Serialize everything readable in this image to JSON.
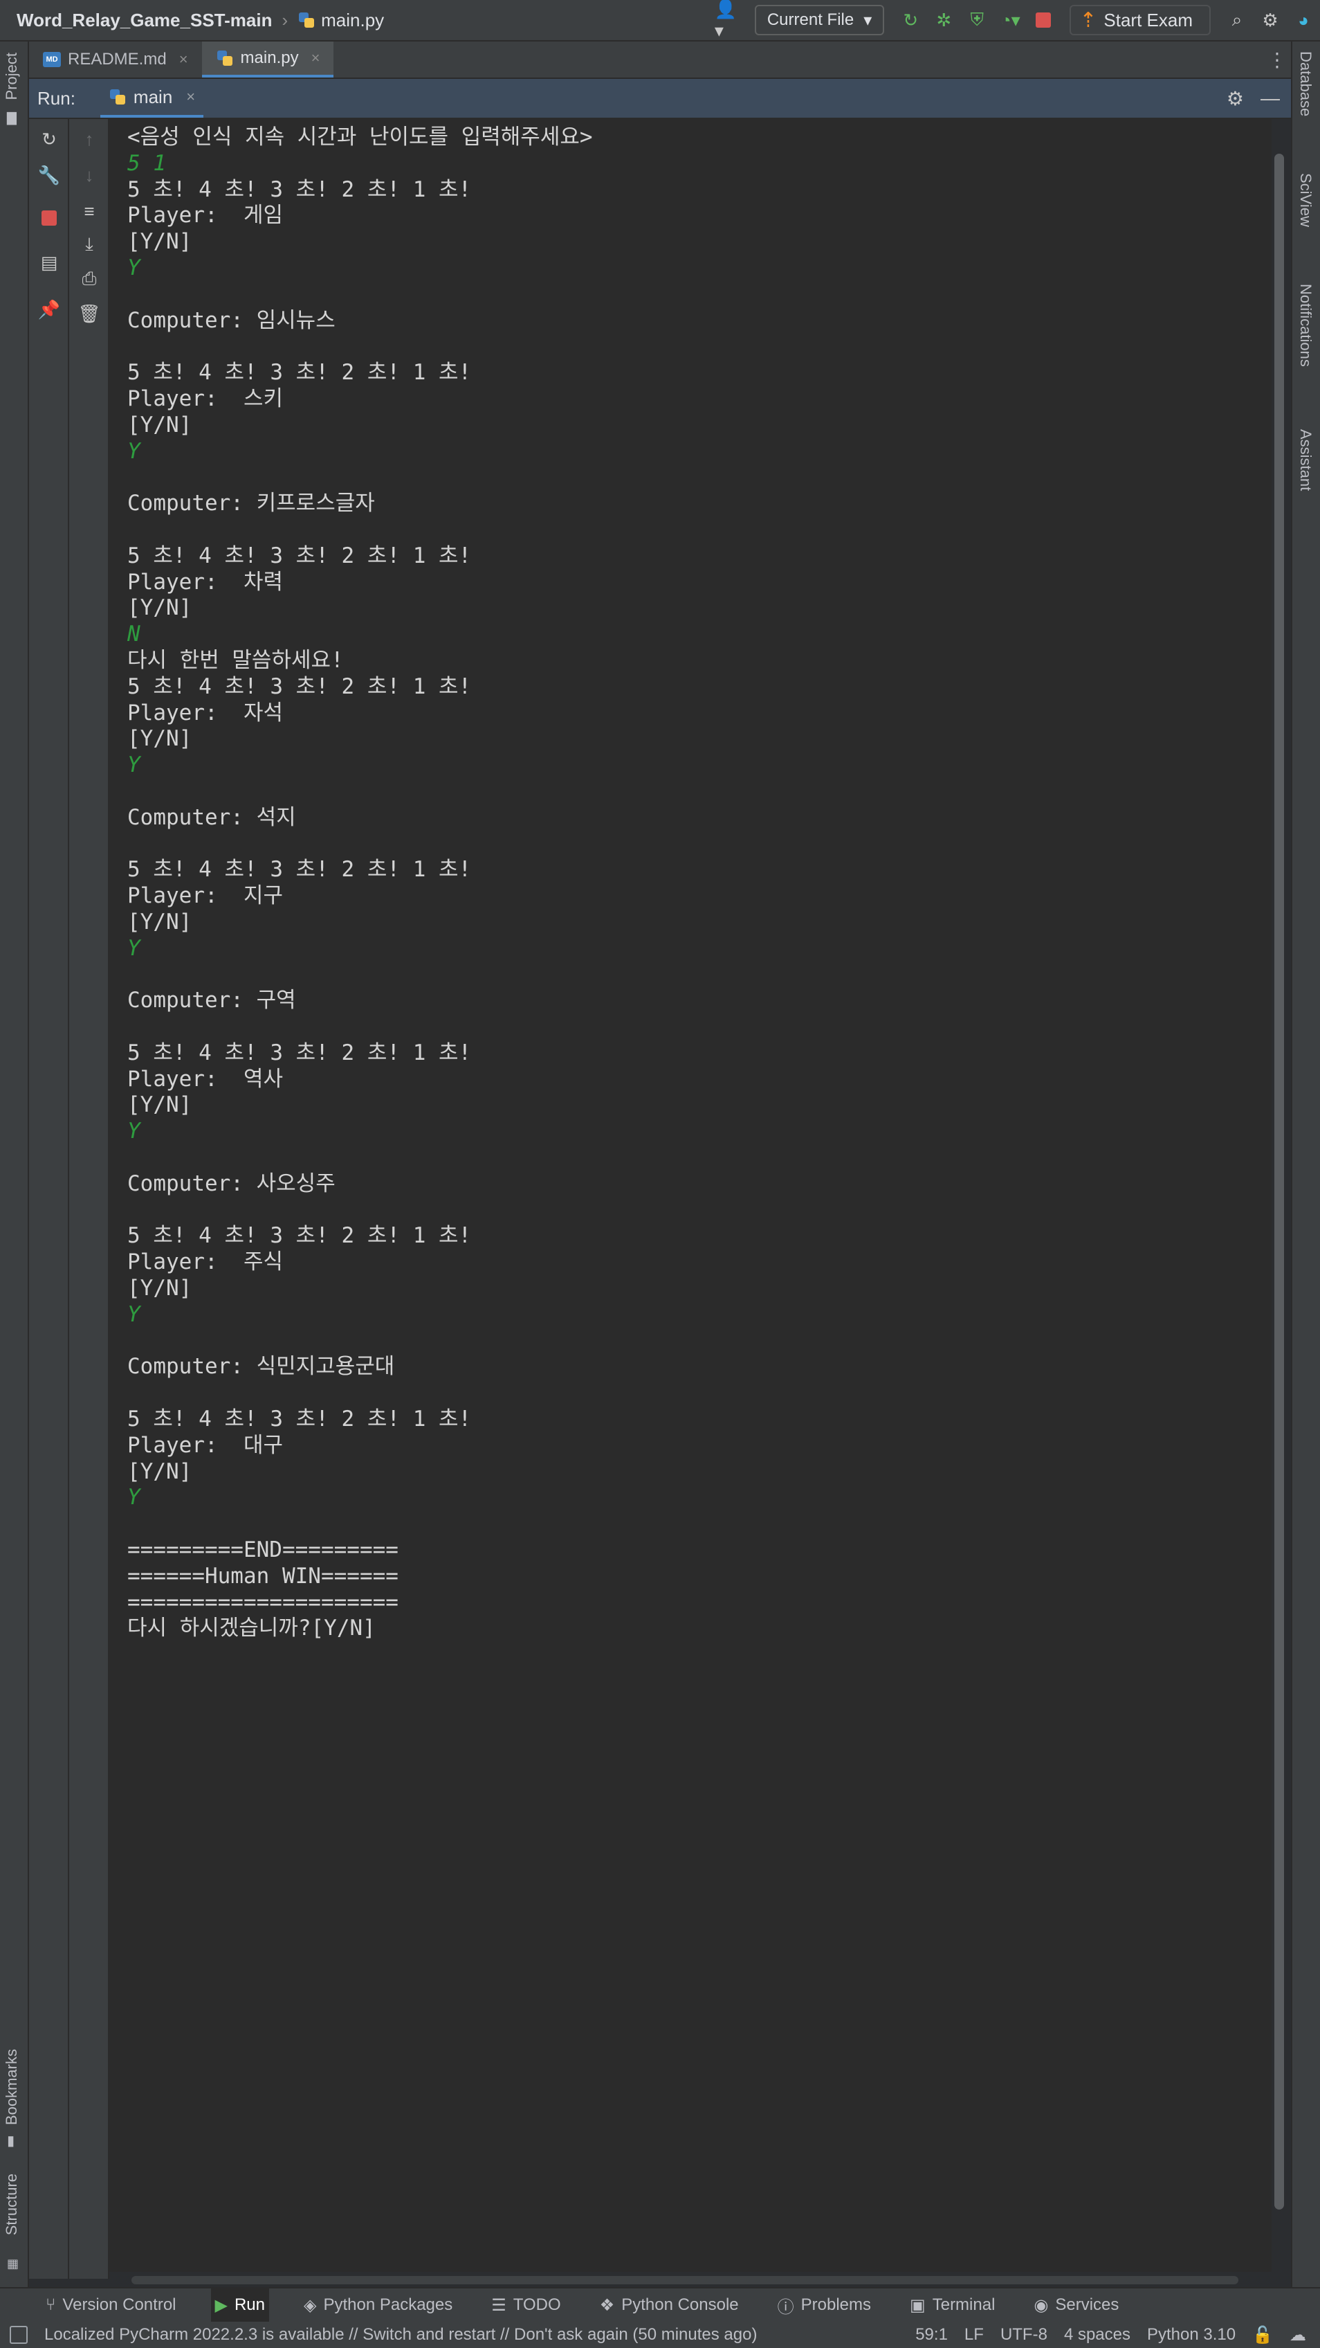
{
  "titlebar": {
    "project": "Word_Relay_Game_SST-main",
    "file": "main.py",
    "run_config": "Current File",
    "exam_label": "Start Exam"
  },
  "left_strip": {
    "project_label": "Project",
    "bookmarks_label": "Bookmarks",
    "structure_label": "Structure"
  },
  "right_strip": {
    "database_label": "Database",
    "sciview_label": "SciView",
    "notifications_label": "Notifications",
    "assistant_label": "Assistant"
  },
  "tabs": [
    {
      "label": "README.md",
      "icon": "markdown-icon",
      "active": false
    },
    {
      "label": "main.py",
      "icon": "python-icon",
      "active": true
    }
  ],
  "run": {
    "label": "Run:",
    "tab": "main"
  },
  "console": [
    {
      "text": "<음성 인식 지속 시간과 난이도를 입력해주세요>",
      "input": false
    },
    {
      "text": "5 1",
      "input": true
    },
    {
      "text": "5 초! 4 초! 3 초! 2 초! 1 초!",
      "input": false
    },
    {
      "text": "Player:  게임",
      "input": false
    },
    {
      "text": "[Y/N]",
      "input": false
    },
    {
      "text": "Y",
      "input": true
    },
    {
      "text": "",
      "input": false
    },
    {
      "text": "Computer: 임시뉴스",
      "input": false
    },
    {
      "text": "",
      "input": false
    },
    {
      "text": "5 초! 4 초! 3 초! 2 초! 1 초!",
      "input": false
    },
    {
      "text": "Player:  스키",
      "input": false
    },
    {
      "text": "[Y/N]",
      "input": false
    },
    {
      "text": "Y",
      "input": true
    },
    {
      "text": "",
      "input": false
    },
    {
      "text": "Computer: 키프로스글자",
      "input": false
    },
    {
      "text": "",
      "input": false
    },
    {
      "text": "5 초! 4 초! 3 초! 2 초! 1 초!",
      "input": false
    },
    {
      "text": "Player:  차력",
      "input": false
    },
    {
      "text": "[Y/N]",
      "input": false
    },
    {
      "text": "N",
      "input": true
    },
    {
      "text": "다시 한번 말씀하세요!",
      "input": false
    },
    {
      "text": "5 초! 4 초! 3 초! 2 초! 1 초!",
      "input": false
    },
    {
      "text": "Player:  자석",
      "input": false
    },
    {
      "text": "[Y/N]",
      "input": false
    },
    {
      "text": "Y",
      "input": true
    },
    {
      "text": "",
      "input": false
    },
    {
      "text": "Computer: 석지",
      "input": false
    },
    {
      "text": "",
      "input": false
    },
    {
      "text": "5 초! 4 초! 3 초! 2 초! 1 초!",
      "input": false
    },
    {
      "text": "Player:  지구",
      "input": false
    },
    {
      "text": "[Y/N]",
      "input": false
    },
    {
      "text": "Y",
      "input": true
    },
    {
      "text": "",
      "input": false
    },
    {
      "text": "Computer: 구역",
      "input": false
    },
    {
      "text": "",
      "input": false
    },
    {
      "text": "5 초! 4 초! 3 초! 2 초! 1 초!",
      "input": false
    },
    {
      "text": "Player:  역사",
      "input": false
    },
    {
      "text": "[Y/N]",
      "input": false
    },
    {
      "text": "Y",
      "input": true
    },
    {
      "text": "",
      "input": false
    },
    {
      "text": "Computer: 사오싱주",
      "input": false
    },
    {
      "text": "",
      "input": false
    },
    {
      "text": "5 초! 4 초! 3 초! 2 초! 1 초!",
      "input": false
    },
    {
      "text": "Player:  주식",
      "input": false
    },
    {
      "text": "[Y/N]",
      "input": false
    },
    {
      "text": "Y",
      "input": true
    },
    {
      "text": "",
      "input": false
    },
    {
      "text": "Computer: 식민지고용군대",
      "input": false
    },
    {
      "text": "",
      "input": false
    },
    {
      "text": "5 초! 4 초! 3 초! 2 초! 1 초!",
      "input": false
    },
    {
      "text": "Player:  대구",
      "input": false
    },
    {
      "text": "[Y/N]",
      "input": false
    },
    {
      "text": "Y",
      "input": true
    },
    {
      "text": "",
      "input": false
    },
    {
      "text": "=========END=========",
      "input": false
    },
    {
      "text": "======Human WIN======",
      "input": false
    },
    {
      "text": "=====================",
      "input": false
    },
    {
      "text": "다시 하시겠습니까?[Y/N]",
      "input": false
    }
  ],
  "toolwindows": [
    {
      "label": "Version Control",
      "icon": "branch-icon",
      "active": false
    },
    {
      "label": "Run",
      "icon": "run-icon",
      "active": true
    },
    {
      "label": "Python Packages",
      "icon": "layers-icon",
      "active": false
    },
    {
      "label": "TODO",
      "icon": "list-icon",
      "active": false
    },
    {
      "label": "Python Console",
      "icon": "python-console-icon",
      "active": false
    },
    {
      "label": "Problems",
      "icon": "warning-icon",
      "active": false
    },
    {
      "label": "Terminal",
      "icon": "terminal-icon",
      "active": false
    },
    {
      "label": "Services",
      "icon": "services-icon",
      "active": false
    }
  ],
  "status": {
    "message": "Localized PyCharm 2022.2.3 is available // Switch and restart // Don't ask again (50 minutes ago)",
    "position": "59:1",
    "line_sep": "LF",
    "encoding": "UTF-8",
    "indent": "4 spaces",
    "interpreter": "Python 3.10"
  },
  "colors": {
    "accent": "#4a88c7",
    "console_input": "#2e9c3f",
    "run_header": "#3d4b5c"
  }
}
